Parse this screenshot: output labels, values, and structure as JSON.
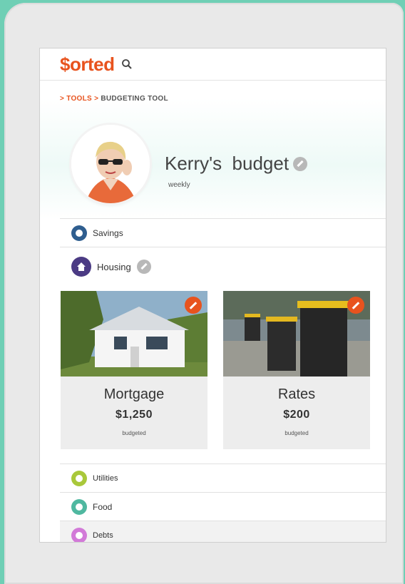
{
  "header": {
    "logo": "$orted"
  },
  "breadcrumb": {
    "sep1": ">",
    "item1": "TOOLS",
    "sep2": ">",
    "item2": "BUDGETING TOOL"
  },
  "profile": {
    "title": "Kerry's  budget",
    "period": "weekly"
  },
  "categories": {
    "savings": {
      "label": "Savings",
      "color": "#2f5e8f"
    },
    "housing": {
      "label": "Housing",
      "color": "#4b3b84"
    },
    "utilities": {
      "label": "Utilities",
      "color": "#a9c83a"
    },
    "food": {
      "label": "Food",
      "color": "#4fb8a0"
    },
    "debts": {
      "label": "Debts",
      "color": "#d27ad8"
    }
  },
  "cards": [
    {
      "name": "Mortgage",
      "amount": "$1,250",
      "status": "budgeted"
    },
    {
      "name": "Rates",
      "amount": "$200",
      "status": "budgeted"
    }
  ],
  "colors": {
    "brand": "#e8531e",
    "background": "#6fcfb5"
  }
}
